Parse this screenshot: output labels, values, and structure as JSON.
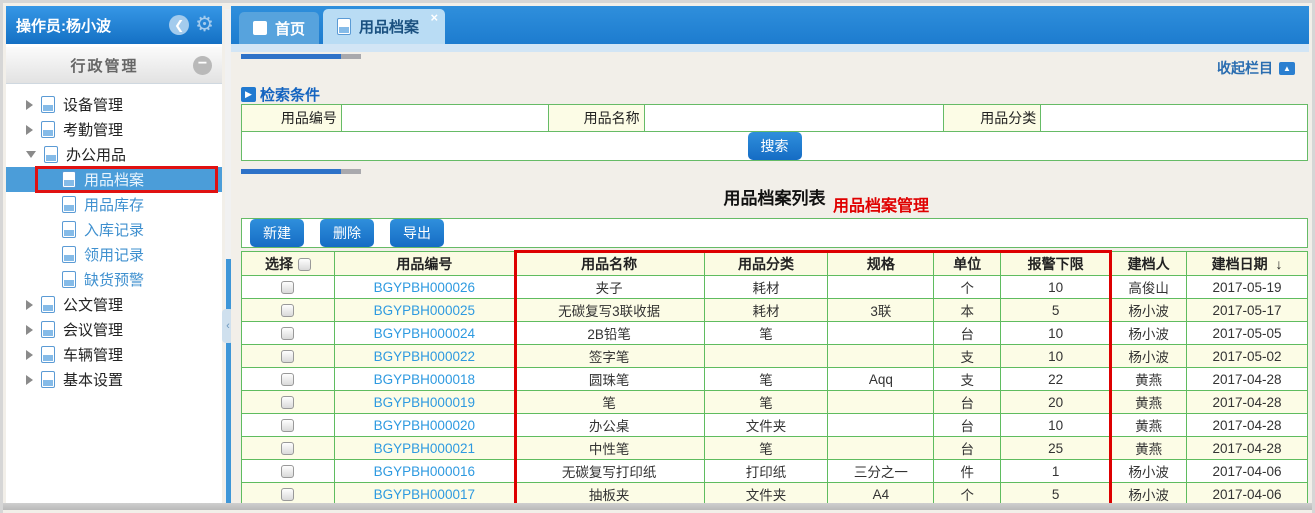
{
  "sidebar": {
    "header": {
      "title": "操作员:杨小波"
    },
    "panel_title": "行政管理",
    "tree": [
      {
        "label": "设备管理",
        "type": "group",
        "state": "collapsed"
      },
      {
        "label": "考勤管理",
        "type": "group",
        "state": "collapsed"
      },
      {
        "label": "办公用品",
        "type": "group",
        "state": "expanded"
      },
      {
        "label": "用品档案",
        "type": "leaf",
        "selected": true,
        "annotated": true
      },
      {
        "label": "用品库存",
        "type": "leaf"
      },
      {
        "label": "入库记录",
        "type": "leaf"
      },
      {
        "label": "领用记录",
        "type": "leaf"
      },
      {
        "label": "缺货预警",
        "type": "leaf"
      },
      {
        "label": "公文管理",
        "type": "group",
        "state": "collapsed"
      },
      {
        "label": "会议管理",
        "type": "group",
        "state": "collapsed"
      },
      {
        "label": "车辆管理",
        "type": "group",
        "state": "collapsed"
      },
      {
        "label": "基本设置",
        "type": "group",
        "state": "collapsed"
      }
    ]
  },
  "tabs": [
    {
      "label": "首页",
      "active": false,
      "closable": false,
      "icon": "home-square-icon"
    },
    {
      "label": "用品档案",
      "active": true,
      "closable": true,
      "icon": "document-icon"
    }
  ],
  "collapse_link": {
    "label": "收起栏目",
    "icon": "collapse-up-icon"
  },
  "search": {
    "title": "检索条件",
    "fields": [
      {
        "label": "用品编号",
        "value": "",
        "placeholder": ""
      },
      {
        "label": "用品名称",
        "value": "",
        "placeholder": ""
      },
      {
        "label": "用品分类",
        "value": "",
        "placeholder": ""
      }
    ],
    "button_label": "搜索"
  },
  "list": {
    "title": "用品档案列表",
    "annotation": "用品档案管理",
    "toolbar": [
      {
        "label": "新建"
      },
      {
        "label": "删除"
      },
      {
        "label": "导出"
      }
    ],
    "columns": [
      "选择",
      "用品编号",
      "用品名称",
      "用品分类",
      "规格",
      "单位",
      "报警下限",
      "建档人",
      "建档日期"
    ],
    "sort": {
      "column": "建档日期",
      "direction": "desc",
      "icon": "↓"
    },
    "rows": [
      {
        "code": "BGYPBH000026",
        "name": "夹子",
        "category": "耗材",
        "spec": "",
        "unit": "个",
        "limit": "10",
        "creator": "高俊山",
        "date": "2017-05-19"
      },
      {
        "code": "BGYPBH000025",
        "name": "无碳复写3联收据",
        "category": "耗材",
        "spec": "3联",
        "unit": "本",
        "limit": "5",
        "creator": "杨小波",
        "date": "2017-05-17"
      },
      {
        "code": "BGYPBH000024",
        "name": "2B铅笔",
        "category": "笔",
        "spec": "",
        "unit": "台",
        "limit": "10",
        "creator": "杨小波",
        "date": "2017-05-05"
      },
      {
        "code": "BGYPBH000022",
        "name": "签字笔",
        "category": "",
        "spec": "",
        "unit": "支",
        "limit": "10",
        "creator": "杨小波",
        "date": "2017-05-02"
      },
      {
        "code": "BGYPBH000018",
        "name": "圆珠笔",
        "category": "笔",
        "spec": "Aqq",
        "unit": "支",
        "limit": "22",
        "creator": "黄燕",
        "date": "2017-04-28"
      },
      {
        "code": "BGYPBH000019",
        "name": "笔",
        "category": "笔",
        "spec": "",
        "unit": "台",
        "limit": "20",
        "creator": "黄燕",
        "date": "2017-04-28"
      },
      {
        "code": "BGYPBH000020",
        "name": "办公桌",
        "category": "文件夹",
        "spec": "",
        "unit": "台",
        "limit": "10",
        "creator": "黄燕",
        "date": "2017-04-28"
      },
      {
        "code": "BGYPBH000021",
        "name": "中性笔",
        "category": "笔",
        "spec": "",
        "unit": "台",
        "limit": "25",
        "creator": "黄燕",
        "date": "2017-04-28"
      },
      {
        "code": "BGYPBH000016",
        "name": "无碳复写打印纸",
        "category": "打印纸",
        "spec": "三分之一",
        "unit": "件",
        "limit": "1",
        "creator": "杨小波",
        "date": "2017-04-06"
      },
      {
        "code": "BGYPBH000017",
        "name": "抽板夹",
        "category": "文件夹",
        "spec": "A4",
        "unit": "个",
        "limit": "5",
        "creator": "杨小波",
        "date": "2017-04-06"
      }
    ]
  },
  "colors": {
    "accent_blue": "#1d7ccf",
    "active_tab": "#b9dcf4",
    "grid_border_green": "#5fbc5f",
    "row_yellow": "#fcfce6",
    "link_blue": "#2e9ae0",
    "annotation_red": "#e00000",
    "selected_item_blue": "#4b9dd9"
  }
}
